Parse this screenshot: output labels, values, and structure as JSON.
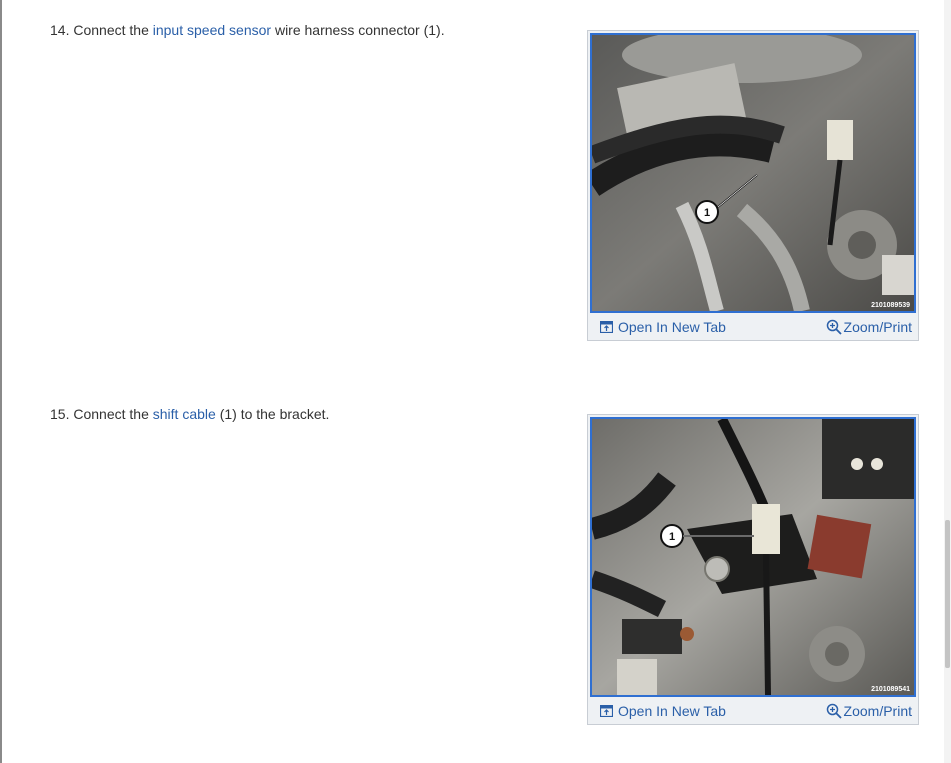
{
  "steps": [
    {
      "number": "14.",
      "pre": "Connect the",
      "link": "input speed sensor",
      "post": "wire harness connector (1).",
      "figure": {
        "callout": "1",
        "image_code": "2101089539",
        "open_tab_label": "Open In New Tab",
        "zoom_label": "Zoom/Print"
      }
    },
    {
      "number": "15.",
      "pre": "Connect the",
      "link": "shift cable",
      "post": "(1) to the bracket.",
      "figure": {
        "callout": "1",
        "image_code": "2101089541",
        "open_tab_label": "Open In New Tab",
        "zoom_label": "Zoom/Print"
      }
    }
  ],
  "colors": {
    "link": "#2a5fa8",
    "photo_border": "#2f6fd1"
  },
  "icons": {
    "open_tab": "open-new-tab-icon",
    "zoom": "zoom-in-icon"
  }
}
